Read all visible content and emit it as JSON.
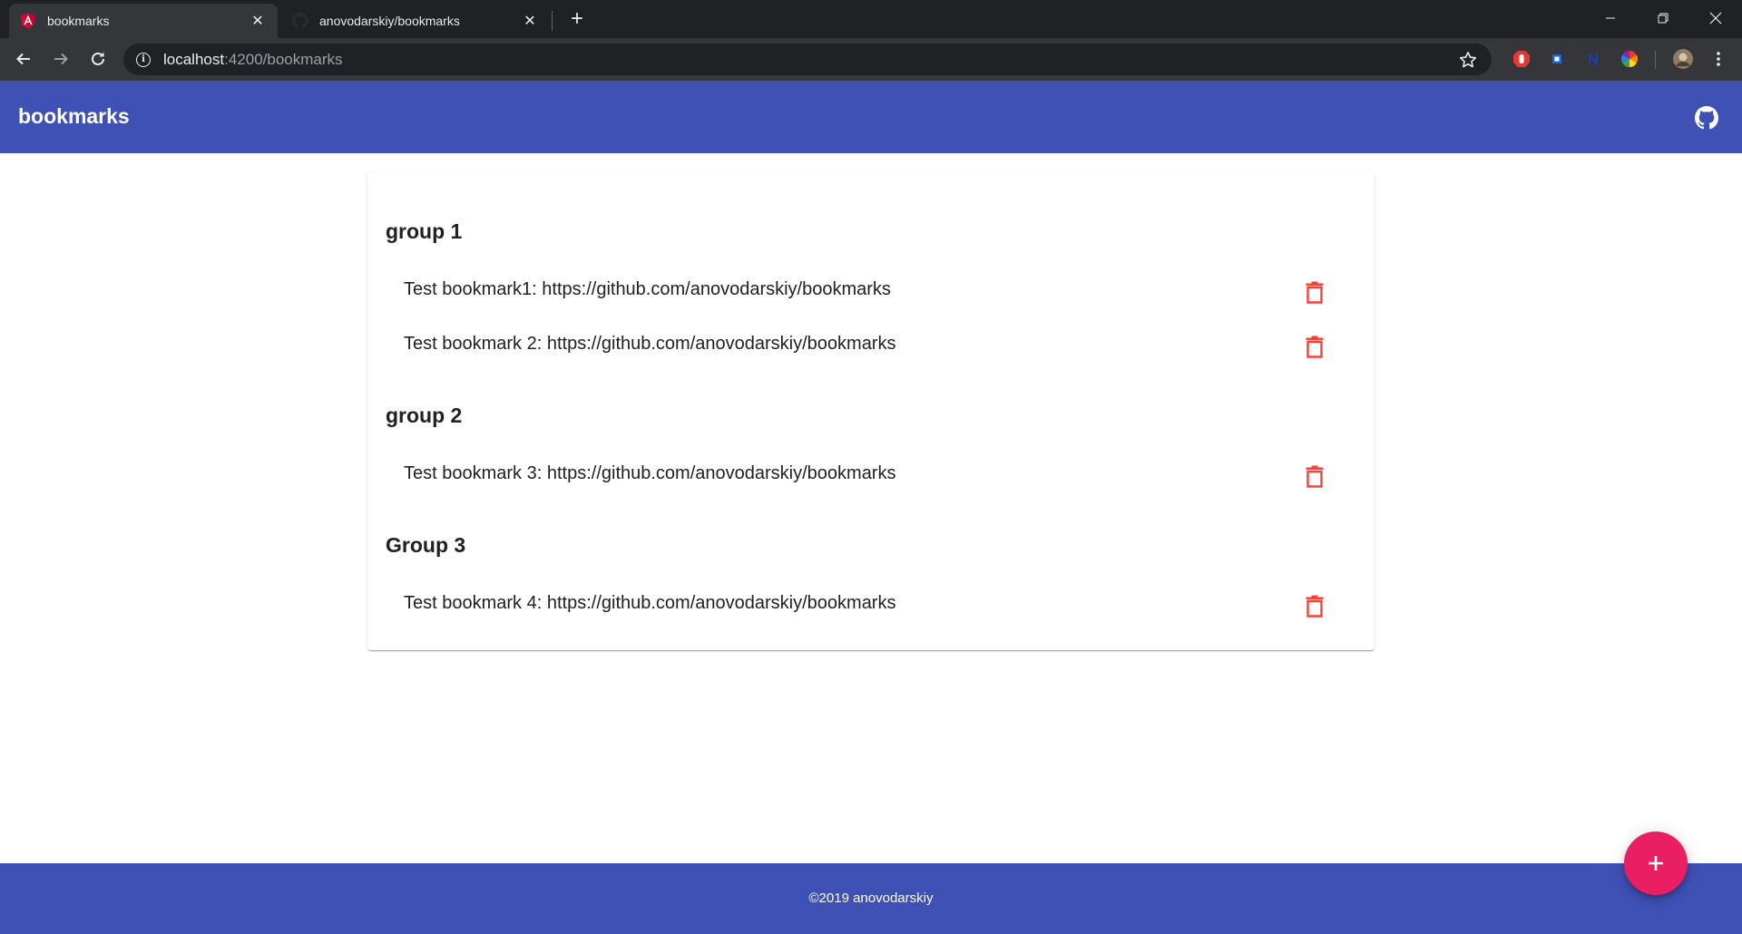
{
  "browser": {
    "tabs": [
      {
        "title": "bookmarks",
        "icon": "angular-icon",
        "active": true
      },
      {
        "title": "anovodarskiy/bookmarks",
        "icon": "github-icon",
        "active": false
      }
    ],
    "url": {
      "host": "localhost",
      "path": ":4200/bookmarks"
    }
  },
  "app": {
    "title": "bookmarks",
    "header_color": "#3f51b5",
    "accent_color": "#e91e63",
    "delete_color": "#f44336"
  },
  "groups": [
    {
      "name": "group 1",
      "bookmarks": [
        {
          "text": "Test bookmark1: https://github.com/anovodarskiy/bookmarks"
        },
        {
          "text": "Test bookmark 2: https://github.com/anovodarskiy/bookmarks"
        }
      ]
    },
    {
      "name": "group 2",
      "bookmarks": [
        {
          "text": "Test bookmark 3: https://github.com/anovodarskiy/bookmarks"
        }
      ]
    },
    {
      "name": "Group 3",
      "bookmarks": [
        {
          "text": "Test bookmark 4: https://github.com/anovodarskiy/bookmarks"
        }
      ]
    }
  ],
  "footer": {
    "text": "©2019 anovodarskiy"
  },
  "fab": {
    "icon": "plus-icon"
  }
}
